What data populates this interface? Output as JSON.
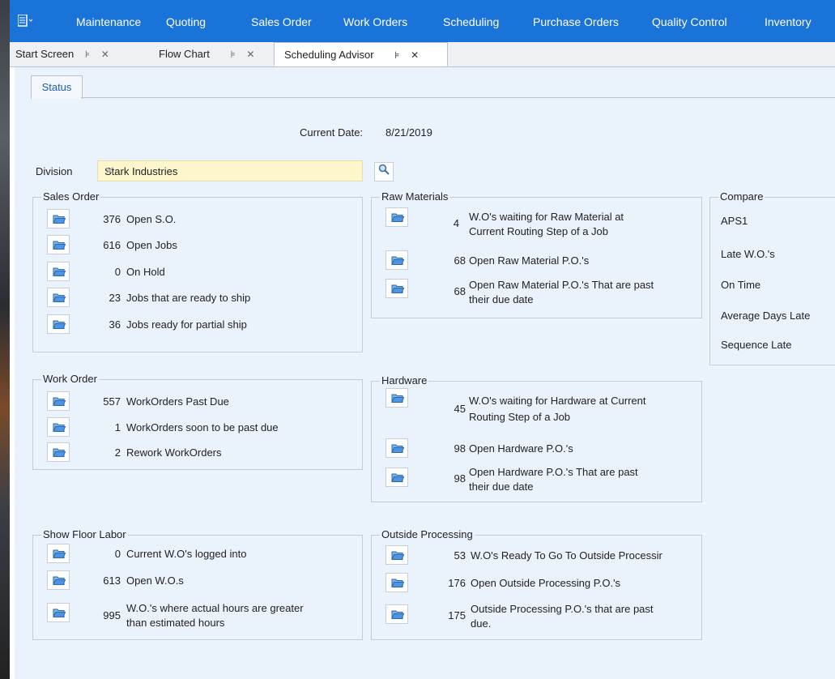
{
  "menu": {
    "items": [
      "Maintenance",
      "Quoting",
      "Sales Order",
      "Work Orders",
      "Scheduling",
      "Purchase Orders",
      "Quality Control",
      "Inventory"
    ]
  },
  "tabs": [
    {
      "label": "Start Screen"
    },
    {
      "label": "Flow Chart"
    },
    {
      "label": "Scheduling Advisor"
    }
  ],
  "subtab": {
    "label": "Status"
  },
  "current_date": {
    "label": "Current Date:",
    "value": "8/21/2019"
  },
  "division": {
    "label": "Division",
    "value": "Stark Industries"
  },
  "sales_order": {
    "title": "Sales Order",
    "rows": [
      {
        "num": "376",
        "text": "Open S.O."
      },
      {
        "num": "616",
        "text": "Open Jobs"
      },
      {
        "num": "0",
        "text": "On Hold"
      },
      {
        "num": "23",
        "text": "Jobs that are ready to ship"
      },
      {
        "num": "36",
        "text": "Jobs ready for partial ship"
      }
    ]
  },
  "raw_materials": {
    "title": "Raw Materials",
    "rows": [
      {
        "num": "4",
        "text1": "W.O's waiting for Raw Material at",
        "text2": "Current Routing Step of a Job"
      },
      {
        "num": "68",
        "text1": "Open Raw Material P.O.'s",
        "text2": ""
      },
      {
        "num": "68",
        "text1": "Open Raw Material P.O.'s That are past",
        "text2": "their due date"
      }
    ]
  },
  "compare": {
    "title": "Compare",
    "items": [
      "APS1",
      "Late W.O.'s",
      "On Time",
      "Average Days Late",
      "Sequence Late"
    ]
  },
  "work_order": {
    "title": "Work Order",
    "rows": [
      {
        "num": "557",
        "text": "WorkOrders Past Due"
      },
      {
        "num": "1",
        "text": "WorkOrders soon to be past due"
      },
      {
        "num": "2",
        "text": "Rework WorkOrders"
      }
    ]
  },
  "hardware": {
    "title": "Hardware",
    "rows": [
      {
        "num": "45",
        "text1": "W.O's waiting for Hardware at Current",
        "text2": "Routing Step of a Job"
      },
      {
        "num": "98",
        "text1": "Open Hardware P.O.'s",
        "text2": ""
      },
      {
        "num": "98",
        "text1": "Open Hardware P.O.'s That are past",
        "text2": "their due date"
      }
    ]
  },
  "shop_floor": {
    "title": "Show Floor Labor",
    "rows": [
      {
        "num": "0",
        "text1": "Current W.O's logged into",
        "text2": ""
      },
      {
        "num": "613",
        "text1": "Open W.O.s",
        "text2": ""
      },
      {
        "num": "995",
        "text1": "W.O.'s where actual hours are greater",
        "text2": "than estimated hours"
      }
    ]
  },
  "outside": {
    "title": "Outside Processing",
    "rows": [
      {
        "num": "53",
        "text1": "W.O's Ready To Go To Outside Processir",
        "text2": ""
      },
      {
        "num": "176",
        "text1": "Open Outside Processing P.O.'s",
        "text2": ""
      },
      {
        "num": "175",
        "text1": "Outside Processing P.O.'s that are past",
        "text2": "due."
      }
    ]
  },
  "colors": {
    "menubar": "#1a73d9",
    "panel": "#eaf2fc",
    "input": "#fdf6cd"
  },
  "icons": {
    "menu": "grid-menu-icon",
    "row": "folder-open-icon",
    "search": "magnifier-icon",
    "close": "close-icon",
    "pin": "pin-icon"
  }
}
